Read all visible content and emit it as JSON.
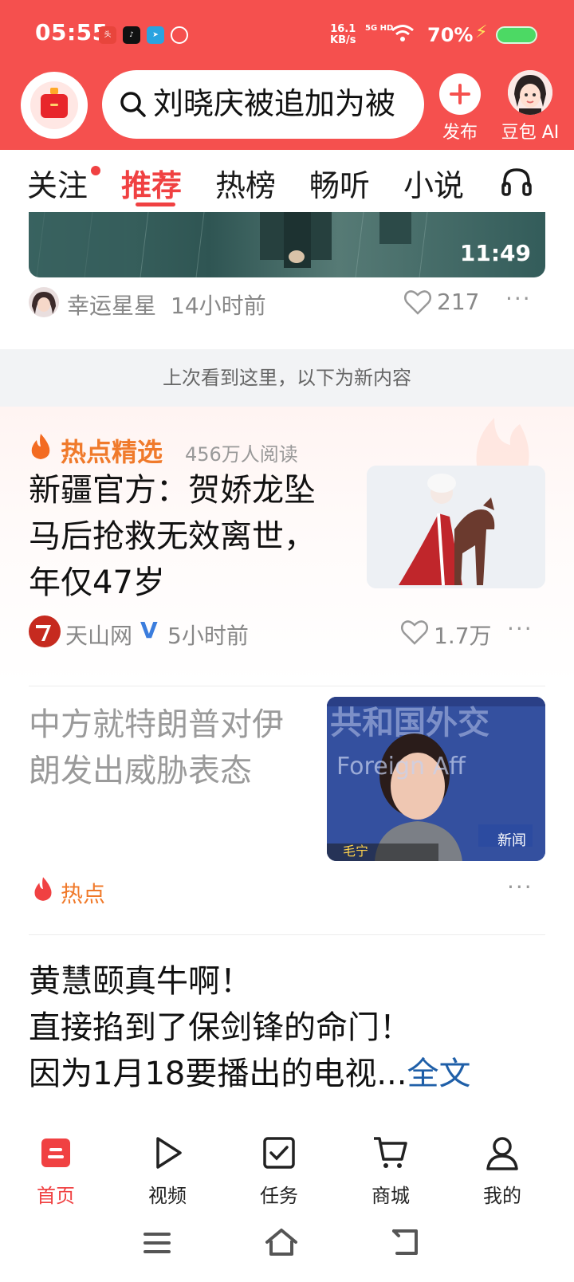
{
  "status_bar": {
    "time": "05:55",
    "net_speed_value": "16.1",
    "net_speed_unit": "KB/s",
    "network": "5G HD",
    "battery": "70%"
  },
  "header": {
    "search_text": "刘晓庆被追加为被",
    "publish_label": "发布",
    "ai_label": "豆包 AI"
  },
  "tabs": [
    "关注",
    "推荐",
    "热榜",
    "畅听",
    "小说"
  ],
  "feed": {
    "video": {
      "duration": "11:49",
      "author": "幸运星星",
      "time": "14小时前",
      "likes": "217"
    },
    "divider_text": "上次看到这里，以下为新内容",
    "hot_pick": {
      "label": "热点精选",
      "reads": "456万人阅读",
      "headline_lines": [
        "新疆官方：贺娇龙坠",
        "马后抢救无效离世，",
        "年仅47岁"
      ],
      "source": "天山网",
      "time": "5小时前",
      "likes": "1.7万"
    },
    "news2": {
      "headline_lines": [
        "中方就特朗普对伊",
        "朗发出威胁表态"
      ],
      "tag": "热点",
      "thumb_caption": "毛宁",
      "thumb_logo": "新闻",
      "thumb_bg_text": "Foreign Aff"
    },
    "post3": {
      "lines": [
        "黄慧颐真牛啊！",
        "直接掐到了保剑锋的命门！",
        "因为1月18要播出的电视..."
      ],
      "full_link": "全文"
    }
  },
  "bottom_nav": [
    "首页",
    "视频",
    "任务",
    "商城",
    "我的"
  ],
  "colors": {
    "brand_red": "#f5504e",
    "accent_red": "#f04142",
    "hot_orange": "#f07a2b",
    "link_blue": "#1f5fa8"
  }
}
